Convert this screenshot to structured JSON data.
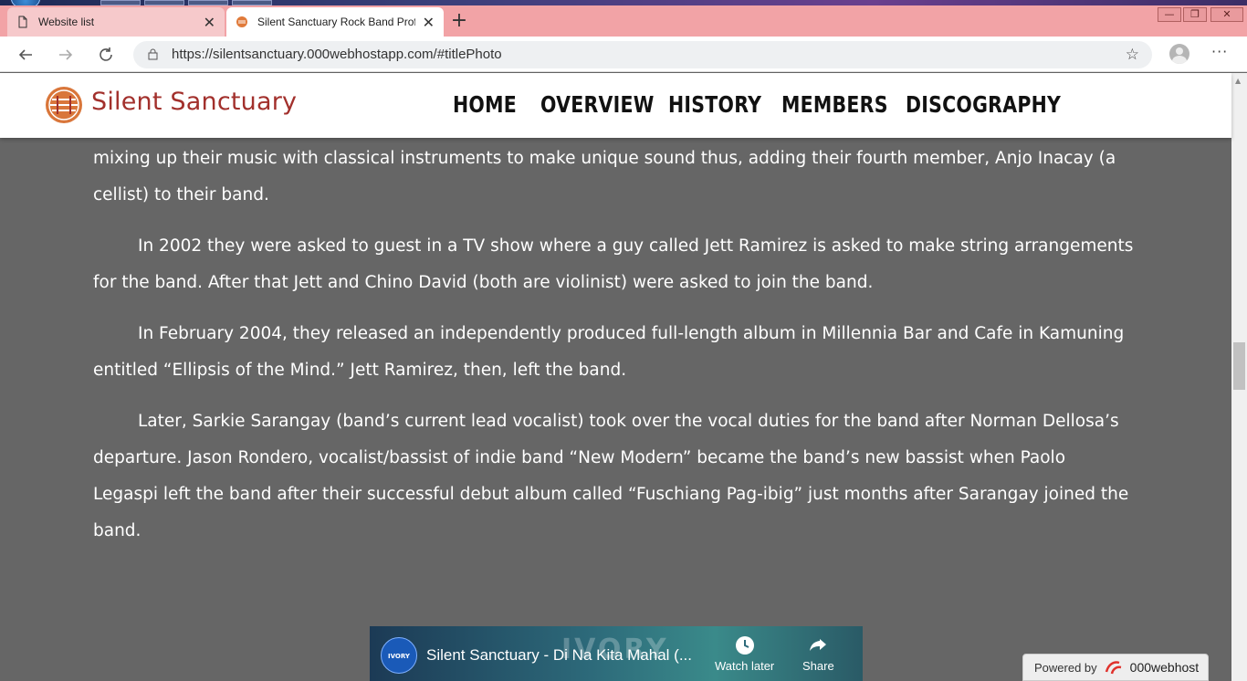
{
  "browser": {
    "tabs": [
      {
        "title": "Website list",
        "active": false
      },
      {
        "title": "Silent Sanctuary Rock Band Profi",
        "active": true
      }
    ],
    "new_tab_symbol": "+",
    "url": "https://silentsanctuary.000webhostapp.com/#titlePhoto",
    "window_controls": [
      "minimize",
      "restore",
      "close"
    ]
  },
  "site": {
    "logo_text": "Silent Sanctuary",
    "brand_color": "#a2302c",
    "nav": [
      "HOME",
      "OVERVIEW",
      "HISTORY",
      "MEMBERS",
      "DISCOGRAPHY"
    ]
  },
  "content": {
    "paragraphs": [
      "mixing up their music with classical instruments to make unique sound thus, adding their fourth member, Anjo Inacay (a cellist) to their band.",
      "In 2002 they were asked to guest in a TV show where a guy called Jett Ramirez is asked to make string arrangements for the band. After that Jett and Chino David (both are violinist) were asked to join the band.",
      "In February 2004, they released an independently produced full-length album in Millennia Bar and Cafe in Kamuning entitled “Ellipsis of the Mind.” Jett Ramirez, then, left the band.",
      "Later, Sarkie Sarangay (band’s current lead vocalist) took over the vocal duties for the band after Norman Dellosa’s departure. Jason Rondero, vocalist/bassist of indie band “New Modern” became the band’s new bassist when Paolo Legaspi left the band after their successful debut album called “Fuschiang Pag-ibig” just months after Sarangay joined the band."
    ]
  },
  "video": {
    "channel_badge": "IVORY",
    "title": "Silent Sanctuary - Di Na Kita Mahal (...",
    "watermark": "IVORY",
    "watch_later_label": "Watch later",
    "share_label": "Share"
  },
  "badge": {
    "powered_by": "Powered by",
    "brand": "000webhost"
  },
  "colors": {
    "page_background": "#666666",
    "tab_strip": "#f2a3a6"
  }
}
